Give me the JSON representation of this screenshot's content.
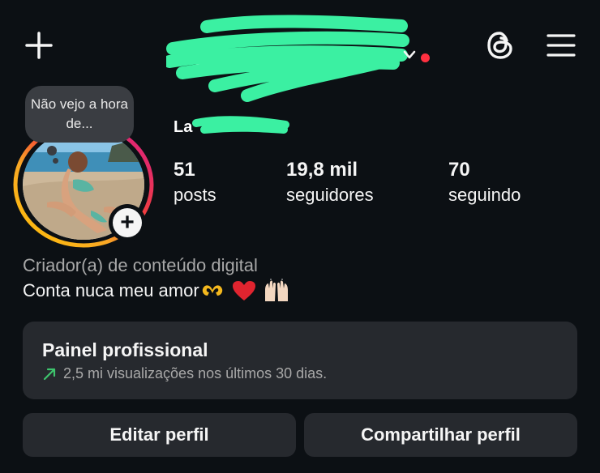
{
  "header": {
    "username": "L____a__",
    "new_post_icon": "plus-icon",
    "threads_icon": "threads-icon",
    "menu_icon": "hamburger-menu-icon",
    "dropdown_icon": "chevron-down-icon",
    "notification_color": "#ff3040"
  },
  "profile": {
    "display_name": "La",
    "note": "Não vejo a hora de...",
    "add_story_icon": "plus-icon"
  },
  "stats": [
    {
      "value": "51",
      "label": "posts"
    },
    {
      "value": "19,8 mil",
      "label": "seguidores"
    },
    {
      "value": "70",
      "label": "seguindo"
    }
  ],
  "bio": {
    "category": "Criador(a) de conteúdo digital",
    "text": "Conta nuca meu amor",
    "emojis": [
      "heart-hands-emoji",
      "red-heart-emoji",
      "raising-hands-emoji"
    ]
  },
  "professional_dashboard": {
    "title": "Painel profissional",
    "subtitle": "2,5 mi visualizações nos últimos 30 dias.",
    "trend_icon": "arrow-up-right-icon",
    "trend_color": "#3ec46d"
  },
  "buttons": {
    "edit_profile": "Editar perfil",
    "share_profile": "Compartilhar perfil"
  },
  "colors": {
    "background": "#0c1014",
    "card": "#26292e",
    "redaction": "#3bf0a2"
  }
}
